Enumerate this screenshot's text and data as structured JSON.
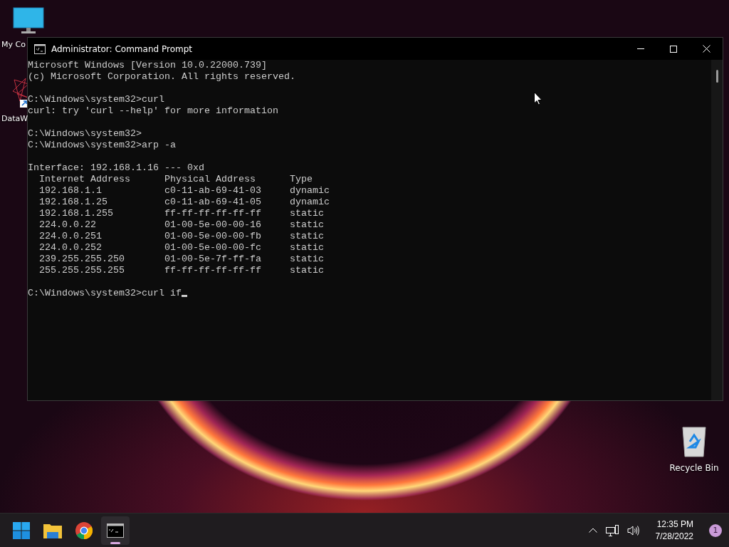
{
  "desktop": {
    "icons": [
      {
        "kind": "monitor",
        "label": "My Co"
      },
      {
        "kind": "shortcut",
        "label": "DataW"
      },
      {
        "kind": "recycle",
        "label": "Recycle Bin"
      }
    ]
  },
  "window": {
    "title": "Administrator: Command Prompt",
    "blocks": [
      {
        "kind": "text",
        "lines": [
          "Microsoft Windows [Version 10.0.22000.739]",
          "(c) Microsoft Corporation. All rights reserved."
        ]
      },
      {
        "kind": "text",
        "lines": [
          "C:\\Windows\\system32>curl",
          "curl: try 'curl --help' for more information"
        ]
      },
      {
        "kind": "text",
        "lines": [
          "C:\\Windows\\system32>",
          "C:\\Windows\\system32>arp -a"
        ]
      },
      {
        "kind": "arp",
        "interface": "Interface: 192.168.1.16 --- 0xd",
        "columns": [
          "Internet Address",
          "Physical Address",
          "Type"
        ],
        "rows": [
          [
            "192.168.1.1",
            "c0-11-ab-69-41-03",
            "dynamic"
          ],
          [
            "192.168.1.25",
            "c0-11-ab-69-41-05",
            "dynamic"
          ],
          [
            "192.168.1.255",
            "ff-ff-ff-ff-ff-ff",
            "static"
          ],
          [
            "224.0.0.22",
            "01-00-5e-00-00-16",
            "static"
          ],
          [
            "224.0.0.251",
            "01-00-5e-00-00-fb",
            "static"
          ],
          [
            "224.0.0.252",
            "01-00-5e-00-00-fc",
            "static"
          ],
          [
            "239.255.255.250",
            "01-00-5e-7f-ff-fa",
            "static"
          ],
          [
            "255.255.255.255",
            "ff-ff-ff-ff-ff-ff",
            "static"
          ]
        ]
      },
      {
        "kind": "text",
        "lines": [
          "C:\\Windows\\system32>curl if"
        ]
      }
    ]
  },
  "taskbar": {
    "apps": [
      {
        "kind": "start",
        "selected": false
      },
      {
        "kind": "folder",
        "selected": false
      },
      {
        "kind": "browser",
        "selected": false
      },
      {
        "kind": "terminal",
        "selected": true
      }
    ],
    "time": "12:35 PM",
    "date": "7/28/2022",
    "notifications": "1"
  }
}
